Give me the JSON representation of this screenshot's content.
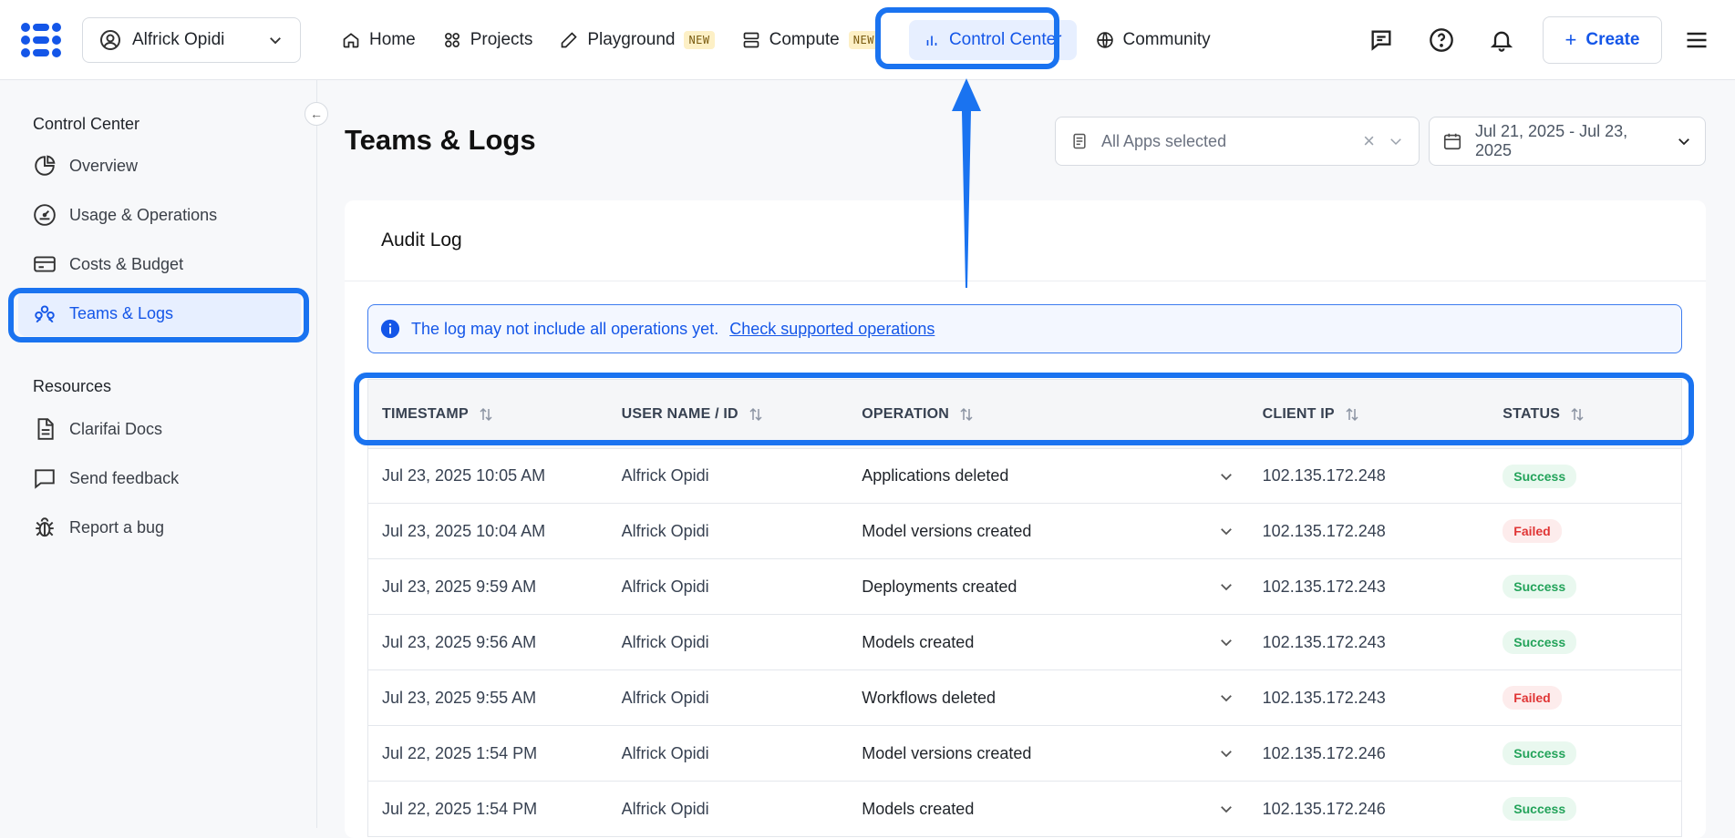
{
  "header": {
    "user_name": "Alfrick Opidi",
    "nav": [
      {
        "label": "Home",
        "icon": "home-icon"
      },
      {
        "label": "Projects",
        "icon": "grid-icon"
      },
      {
        "label": "Playground",
        "icon": "pencil-icon",
        "badge": "NEW"
      },
      {
        "label": "Compute",
        "icon": "server-icon",
        "badge": "NEW"
      },
      {
        "label": "Control Center",
        "icon": "bar-chart-icon",
        "active": true
      },
      {
        "label": "Community",
        "icon": "globe-icon"
      }
    ],
    "create_label": "Create"
  },
  "sidebar": {
    "section1": "Control Center",
    "items1": [
      {
        "label": "Overview",
        "icon": "pie-chart-icon"
      },
      {
        "label": "Usage & Operations",
        "icon": "gauge-icon"
      },
      {
        "label": "Costs & Budget",
        "icon": "credit-card-icon"
      },
      {
        "label": "Teams & Logs",
        "icon": "team-icon",
        "active": true
      }
    ],
    "section2": "Resources",
    "items2": [
      {
        "label": "Clarifai Docs",
        "icon": "document-icon"
      },
      {
        "label": "Send feedback",
        "icon": "message-icon"
      },
      {
        "label": "Report a bug",
        "icon": "bug-icon"
      }
    ]
  },
  "main": {
    "title": "Teams & Logs",
    "apps_filter": "All Apps selected",
    "date_range": "Jul 21, 2025 - Jul 23, 2025",
    "card_title": "Audit Log",
    "banner_text": "The log may not include all operations yet.",
    "banner_link": "Check supported operations",
    "columns": [
      "TIMESTAMP",
      "USER NAME / ID",
      "OPERATION",
      "CLIENT IP",
      "STATUS"
    ],
    "rows": [
      {
        "timestamp": "Jul 23, 2025 10:05 AM",
        "user": "Alfrick Opidi",
        "operation": "Applications deleted",
        "ip": "102.135.172.248",
        "status": "Success"
      },
      {
        "timestamp": "Jul 23, 2025 10:04 AM",
        "user": "Alfrick Opidi",
        "operation": "Model versions created",
        "ip": "102.135.172.248",
        "status": "Failed"
      },
      {
        "timestamp": "Jul 23, 2025 9:59 AM",
        "user": "Alfrick Opidi",
        "operation": "Deployments created",
        "ip": "102.135.172.243",
        "status": "Success"
      },
      {
        "timestamp": "Jul 23, 2025 9:56 AM",
        "user": "Alfrick Opidi",
        "operation": "Models created",
        "ip": "102.135.172.243",
        "status": "Success"
      },
      {
        "timestamp": "Jul 23, 2025 9:55 AM",
        "user": "Alfrick Opidi",
        "operation": "Workflows deleted",
        "ip": "102.135.172.243",
        "status": "Failed"
      },
      {
        "timestamp": "Jul 22, 2025 1:54 PM",
        "user": "Alfrick Opidi",
        "operation": "Model versions created",
        "ip": "102.135.172.246",
        "status": "Success"
      },
      {
        "timestamp": "Jul 22, 2025 1:54 PM",
        "user": "Alfrick Opidi",
        "operation": "Models created",
        "ip": "102.135.172.246",
        "status": "Success"
      }
    ]
  },
  "colors": {
    "accent": "#1456e8",
    "annotation": "#1a73f0",
    "success": "#23a35a",
    "failed": "#e03535"
  }
}
